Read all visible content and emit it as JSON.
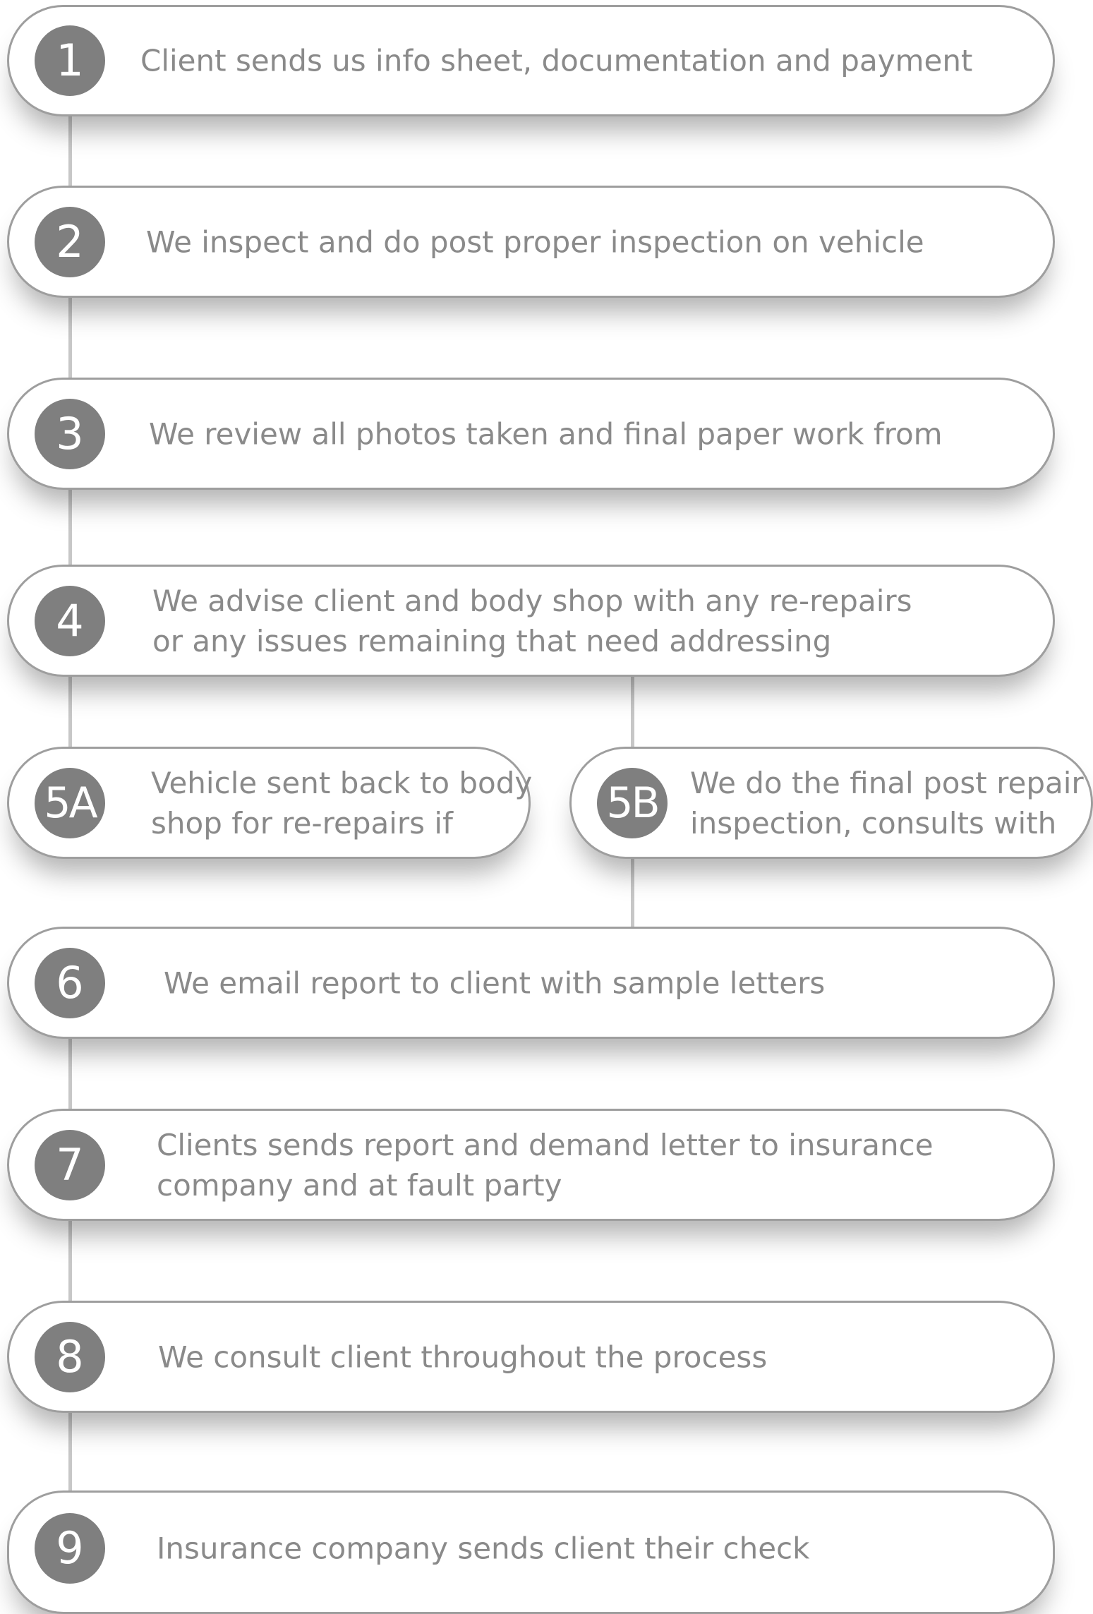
{
  "steps": [
    {
      "id": "1",
      "lines": [
        "Client sends us  info sheet, documentation  and payment"
      ]
    },
    {
      "id": "2",
      "lines": [
        "We inspect and do post proper inspection on vehicle"
      ]
    },
    {
      "id": "3",
      "lines": [
        "We review all photos taken and final paper work from"
      ]
    },
    {
      "id": "4",
      "lines": [
        "We advise client and body shop with any re-repairs",
        "or any issues remaining that need addressing"
      ]
    },
    {
      "id": "5A",
      "lines": [
        "Vehicle sent back to body",
        "shop for re-repairs if"
      ]
    },
    {
      "id": "5B",
      "lines": [
        "We do the final post repair",
        "inspection, consults with"
      ]
    },
    {
      "id": "6",
      "lines": [
        "We email report to client with sample letters"
      ]
    },
    {
      "id": "7",
      "lines": [
        "Clients sends report and demand letter to insurance",
        "company and at fault party"
      ]
    },
    {
      "id": "8",
      "lines": [
        "We consult client throughout the process"
      ]
    },
    {
      "id": "9",
      "lines": [
        "Insurance company sends client their check"
      ]
    }
  ],
  "colors": {
    "badge": "#7f7f7f",
    "text": "#8a8a8a",
    "border": "#9e9e9e",
    "connector": "#c7c7c7"
  }
}
